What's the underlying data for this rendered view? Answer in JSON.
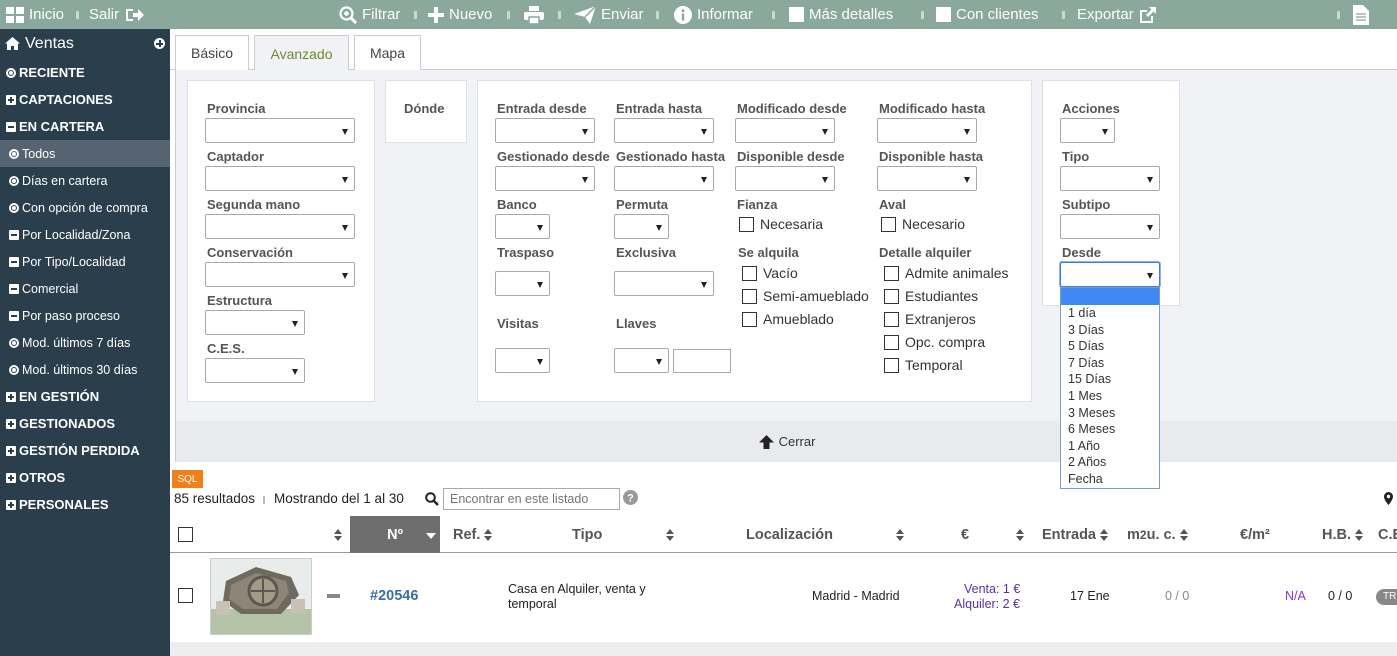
{
  "topbar": {
    "inicio": "Inicio",
    "salir": "Salir",
    "filtrar": "Filtrar",
    "nuevo": "Nuevo",
    "enviar": "Enviar",
    "informar": "Informar",
    "mas_detalles": "Más detalles",
    "con_clientes": "Con clientes",
    "exportar": "Exportar",
    "icons": [
      "grid-icon",
      "logout-icon",
      "zoom-icon",
      "plus-icon",
      "print-icon",
      "send-icon",
      "info-icon",
      "external-link-icon",
      "document-icon"
    ]
  },
  "sidebar": {
    "title": "Ventas",
    "items": [
      {
        "label": "RECIENTE",
        "icon": "circle"
      },
      {
        "label": "CAPTACIONES",
        "icon": "plus"
      },
      {
        "label": "EN CARTERA",
        "icon": "minus"
      },
      {
        "label": "Todos",
        "icon": "circle"
      },
      {
        "label": "Días en cartera",
        "icon": "circle"
      },
      {
        "label": "Con opción de compra",
        "icon": "circle"
      },
      {
        "label": "Por Localidad/Zona",
        "icon": "minus"
      },
      {
        "label": "Por Tipo/Localidad",
        "icon": "minus"
      },
      {
        "label": "Comercial",
        "icon": "minus"
      },
      {
        "label": "Por paso proceso",
        "icon": "minus"
      },
      {
        "label": "Mod. últimos 7 días",
        "icon": "circle"
      },
      {
        "label": "Mod. últimos 30 días",
        "icon": "circle"
      },
      {
        "label": "EN GESTIÓN",
        "icon": "plus"
      },
      {
        "label": "GESTIONADOS",
        "icon": "plus"
      },
      {
        "label": "GESTIÓN PERDIDA",
        "icon": "plus"
      },
      {
        "label": "OTROS",
        "icon": "plus"
      },
      {
        "label": "PERSONALES",
        "icon": "plus"
      }
    ]
  },
  "tabs": [
    "Básico",
    "Avanzado",
    "Mapa"
  ],
  "filters": {
    "provincia": "Provincia",
    "captador": "Captador",
    "segunda_mano": "Segunda mano",
    "conservacion": "Conservación",
    "estructura": "Estructura",
    "ces": "C.E.S.",
    "donde": "Dónde",
    "entrada_desde": "Entrada desde",
    "entrada_hasta": "Entrada hasta",
    "modificado_desde": "Modificado desde",
    "modificado_hasta": "Modificado hasta",
    "gestionado_desde": "Gestionado desde",
    "gestionado_hasta": "Gestionado hasta",
    "disponible_desde": "Disponible desde",
    "disponible_hasta": "Disponible hasta",
    "banco": "Banco",
    "permuta": "Permuta",
    "fianza": "Fianza",
    "fianza_necesaria": "Necesaria",
    "aval": "Aval",
    "aval_necesario": "Necesario",
    "traspaso": "Traspaso",
    "exclusiva": "Exclusiva",
    "se_alquila": "Se alquila",
    "vacio": "Vacío",
    "semi_amueblado": "Semi-amueblado",
    "amueblado": "Amueblado",
    "detalle_alquiler": "Detalle alquiler",
    "admite_animales": "Admite animales",
    "estudiantes": "Estudiantes",
    "extranjeros": "Extranjeros",
    "opc_compra": "Opc. compra",
    "temporal": "Temporal",
    "visitas": "Visitas",
    "llaves": "Llaves",
    "acciones": "Acciones",
    "tipo": "Tipo",
    "subtipo": "Subtipo",
    "desde": "Desde",
    "desde_options": [
      "1 día",
      "3 Días",
      "5 Días",
      "7 Días",
      "15 Días",
      "1 Mes",
      "3 Meses",
      "6 Meses",
      "1 Año",
      "2 Años",
      "Fecha"
    ],
    "cerrar": "Cerrar"
  },
  "results": {
    "sql": "SQL",
    "count": "85 resultados",
    "showing": "Mostrando del 1 al 30",
    "search_placeholder": "Encontrar en este listado"
  },
  "table": {
    "headers": {
      "num": "Nº",
      "ref": "Ref.",
      "tipo": "Tipo",
      "localizacion": "Localización",
      "euro": "€",
      "entrada": "Entrada",
      "m2_main": "m",
      "m2_sub": "2",
      "m2_rest": " u. c.",
      "eurm2": "€/m²",
      "hb": "H.B.",
      "ce": "C.E."
    },
    "rows": [
      {
        "num": "#20546",
        "tipo": "Casa en Alquiler, venta y",
        "tipo2": "temporal",
        "localizacion": "Madrid - Madrid",
        "venta": "Venta: 1 €",
        "alquiler": "Alquiler: 2 €",
        "entrada": "17 Ene",
        "m2": "0 / 0",
        "eurm2": "N/A",
        "hb": "0 / 0",
        "ce": "TR"
      }
    ]
  },
  "colors": {
    "topbar": "#8aa89c",
    "sidebar": "#2b3e4c",
    "accent_green": "#6b8a33",
    "link_blue": "#3b6ea8",
    "purple": "#5a2fa3",
    "sql_orange": "#f0811a"
  }
}
